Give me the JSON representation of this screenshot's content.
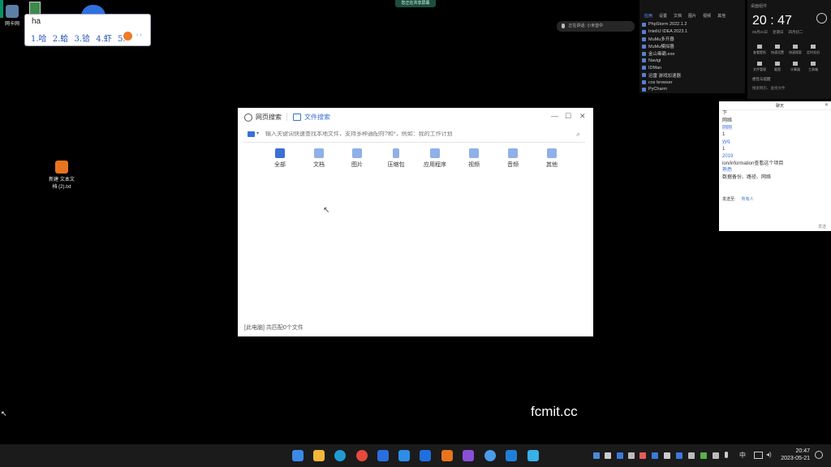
{
  "desktop": {
    "icon1_label": "网卡网",
    "icon2_label": "新建 文本文\n档 (2).txt",
    "watermark": "fcmit.cc"
  },
  "top_notice": "您正在共享屏幕",
  "ime": {
    "input": "ha",
    "candidates": [
      "1.哈",
      "2.蛤",
      "3.铪",
      "4.虾",
      "5."
    ]
  },
  "voice_pill": "正在讲话: 小米音中",
  "search_window": {
    "tab_web": "网页搜索",
    "tab_files": "文件搜索",
    "search_placeholder": "输入关键词快速查找本地文件，支持多种通配符?和*，例如：我的工作计划",
    "categories": [
      "全部",
      "文档",
      "图片",
      "压缩包",
      "应用程序",
      "视频",
      "音频",
      "其他"
    ],
    "status": "[此电脑] 共匹配0个文件",
    "controls": [
      "—",
      "☐",
      "✕"
    ]
  },
  "apps_panel": {
    "tabs": [
      "应用",
      "设置",
      "文档",
      "图片",
      "视频",
      "其他"
    ],
    "items": [
      "PhpStorm 2022.1.2",
      "IntelliJ IDEA 2023.1",
      "MuMu多开器",
      "MuMu模拟器",
      "金山毒霸.exe",
      "Navigi",
      "IDMan",
      "迅雷 游戏加速器",
      "cos browser",
      "PyCharm"
    ]
  },
  "clock": {
    "header": "桌面组件",
    "time": "20 : 47",
    "date": "05月21日",
    "weekday": "星期日",
    "lunar": "四月初二",
    "shortcuts": [
      "查看壁纸",
      "快速设置",
      "快速搜索",
      "定时关机",
      "文件管理",
      "截图",
      "计算器",
      "工具箱"
    ],
    "footer": "便签与提醒",
    "search_hint": "搜索网页、查找文件"
  },
  "chat": {
    "title": "聊天",
    "lines": [
      "下",
      "网络",
      "刚刚",
      "1",
      "yyq",
      "1",
      "2019",
      "ion/information查看这个项目",
      "熟悉",
      "数据备份、路径、网络"
    ],
    "send_to_label": "发送至:",
    "send_to": "所有人",
    "send_btn": "发送"
  },
  "taskbar": {
    "apps": [
      "windows-start",
      "file-explorer",
      "edge",
      "chrome",
      "feishu",
      "mumu",
      "pycharm-p",
      "sublime",
      "phpstorm",
      "clash",
      "vscode",
      "app-2"
    ],
    "tray_lang": "中",
    "time": "20:47",
    "date": "2023-05-21"
  },
  "colors": {
    "accent": "#3a6fd8",
    "corner": "#0a8f6a"
  }
}
